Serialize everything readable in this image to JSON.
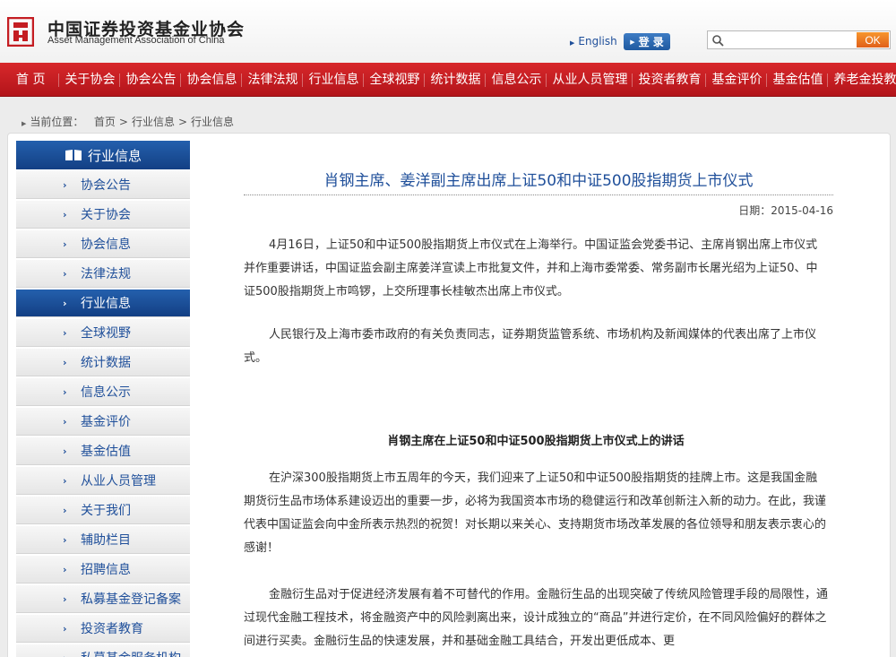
{
  "header": {
    "org_name_cn": "中国证券投资基金业协会",
    "org_name_en": "Asset Management Association of China",
    "lang_link": "English",
    "login_label": "登 录",
    "search_placeholder": "",
    "search_button": "OK"
  },
  "nav": {
    "items": [
      "首 页",
      "关于协会",
      "协会公告",
      "协会信息",
      "法律法规",
      "行业信息",
      "全球视野",
      "统计数据",
      "信息公示",
      "从业人员管理",
      "投资者教育",
      "基金评价",
      "基金估值",
      "养老金投教"
    ]
  },
  "breadcrumb": {
    "label": "当前位置：",
    "path": [
      "首页",
      "行业信息",
      "行业信息"
    ]
  },
  "sidebar": {
    "heading": "行业信息",
    "items": [
      {
        "label": "协会公告",
        "active": false
      },
      {
        "label": "关于协会",
        "active": false
      },
      {
        "label": "协会信息",
        "active": false
      },
      {
        "label": "法律法规",
        "active": false
      },
      {
        "label": "行业信息",
        "active": true
      },
      {
        "label": "全球视野",
        "active": false
      },
      {
        "label": "统计数据",
        "active": false
      },
      {
        "label": "信息公示",
        "active": false
      },
      {
        "label": "基金评价",
        "active": false
      },
      {
        "label": "基金估值",
        "active": false
      },
      {
        "label": "从业人员管理",
        "active": false
      },
      {
        "label": "关于我们",
        "active": false
      },
      {
        "label": "辅助栏目",
        "active": false
      },
      {
        "label": "招聘信息",
        "active": false
      },
      {
        "label": "私募基金登记备案",
        "active": false
      },
      {
        "label": "投资者教育",
        "active": false
      },
      {
        "label": "私募基金服务机构",
        "active": false
      }
    ]
  },
  "article": {
    "title": "肖钢主席、姜洋副主席出席上证50和中证500股指期货上市仪式",
    "date": "日期：2015-04-16",
    "paragraphs": [
      "4月16日，上证50和中证500股指期货上市仪式在上海举行。中国证监会党委书记、主席肖钢出席上市仪式并作重要讲话，中国证监会副主席姜洋宣读上市批复文件，并和上海市委常委、常务副市长屠光绍为上证50、中证500股指期货上市鸣锣，上交所理事长桂敏杰出席上市仪式。",
      "人民银行及上海市委市政府的有关负责同志，证券期货监管系统、市场机构及新闻媒体的代表出席了上市仪式。"
    ],
    "subheading": "肖钢主席在上证50和中证500股指期货上市仪式上的讲话",
    "speech": [
      "在沪深300股指期货上市五周年的今天，我们迎来了上证50和中证500股指期货的挂牌上市。这是我国金融期货衍生品市场体系建设迈出的重要一步，必将为我国资本市场的稳健运行和改革创新注入新的动力。在此，我谨代表中国证监会向中金所表示热烈的祝贺！对长期以来关心、支持期货市场改革发展的各位领导和朋友表示衷心的感谢！",
      "金融衍生品对于促进经济发展有着不可替代的作用。金融衍生品的出现突破了传统风险管理手段的局限性，通过现代金融工程技术，将金融资产中的风险剥离出来，设计成独立的“商品”并进行定价，在不同风险偏好的群体之间进行买卖。金融衍生品的快速发展，并和基础金融工具结合，开发出更低成本、更"
    ]
  },
  "colors": {
    "nav_red": "#c41d22",
    "brand_blue": "#1f4f9a",
    "ok_orange": "#f08023"
  }
}
